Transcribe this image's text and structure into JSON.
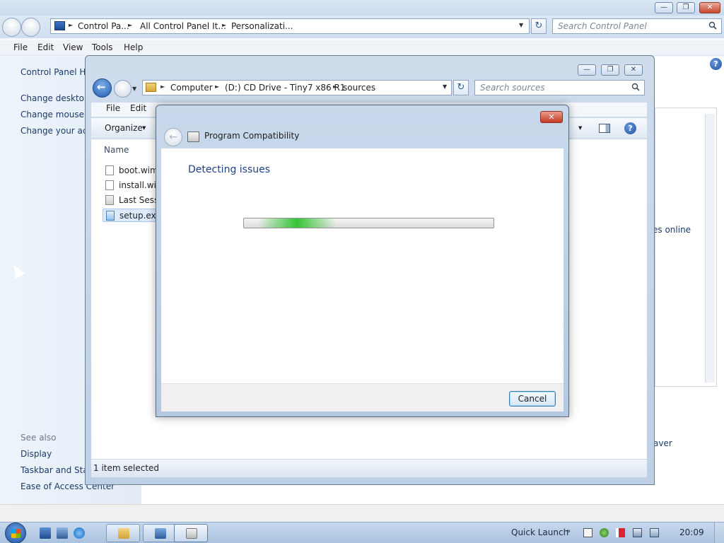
{
  "control_panel": {
    "breadcrumb": [
      "Control Pa...",
      "All Control Panel It...",
      "Personalizati..."
    ],
    "search_placeholder": "Search Control Panel",
    "menu": [
      "File",
      "Edit",
      "View",
      "Tools",
      "Help"
    ],
    "left_links": [
      "Control Panel Ho",
      "Change desktop",
      "Change mouse p",
      "Change your acc"
    ],
    "see_also_label": "See also",
    "see_also_links": [
      "Display",
      "Taskbar and Start",
      "Ease of Access Center"
    ],
    "right_fragments": {
      "online": "es online",
      "saver": "aver"
    }
  },
  "explorer": {
    "breadcrumb": [
      "Computer",
      "(D:) CD Drive - Tiny7 x86 R1",
      "sources"
    ],
    "search_placeholder": "Search sources",
    "menu": [
      "File",
      "Edit"
    ],
    "organize_label": "Organize",
    "column_name": "Name",
    "files": [
      {
        "name": "boot.wim",
        "selected": false
      },
      {
        "name": "install.wim",
        "selected": false
      },
      {
        "name": "Last Sessio",
        "selected": false
      },
      {
        "name": "setup.exe",
        "selected": true
      }
    ],
    "status": "1 item selected"
  },
  "dialog": {
    "title": "Program Compatibility",
    "heading": "Detecting issues",
    "cancel_label": "Cancel",
    "progress_indeterminate": true,
    "close_glyph": "✕",
    "back_glyph": "←",
    "accent_color": "#1f3f84",
    "progress_color": "#34c434"
  },
  "taskbar": {
    "quick_launch_label": "Quick Launch",
    "quick_launch_chevron": "»",
    "clock": "20:09"
  },
  "glyphs": {
    "chevron_right": "►",
    "chevron_down": "▼",
    "refresh": "↻",
    "help": "?",
    "minimize": "—",
    "restore": "❐",
    "close": "✕"
  }
}
